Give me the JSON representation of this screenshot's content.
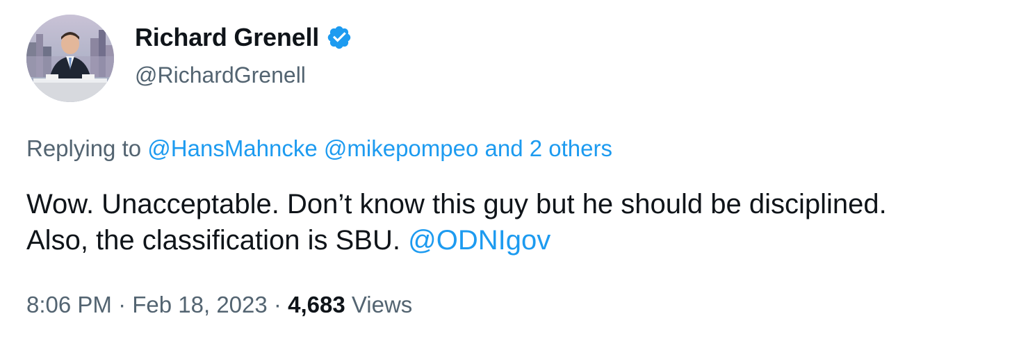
{
  "author": {
    "display_name": "Richard Grenell",
    "handle": "@RichardGrenell",
    "verified_icon": "verified-badge-icon",
    "avatar_icon": "profile-avatar"
  },
  "reply": {
    "prefix": "Replying to",
    "mentions": [
      "@HansMahncke",
      "@mikepompeo"
    ],
    "suffix": "and 2 others"
  },
  "tweet": {
    "line1": "Wow. Unacceptable. Don’t know this guy but he should be disciplined.",
    "line2_text": "Also, the classification is SBU.",
    "line2_mention": "@ODNIgov"
  },
  "meta": {
    "time": "8:06 PM",
    "separator": "·",
    "date": "Feb 18, 2023",
    "views_count": "4,683",
    "views_label": "Views"
  },
  "colors": {
    "link": "#1d9bf0",
    "secondary_text": "#536471",
    "primary_text": "#0f1419",
    "verified": "#1d9bf0"
  }
}
